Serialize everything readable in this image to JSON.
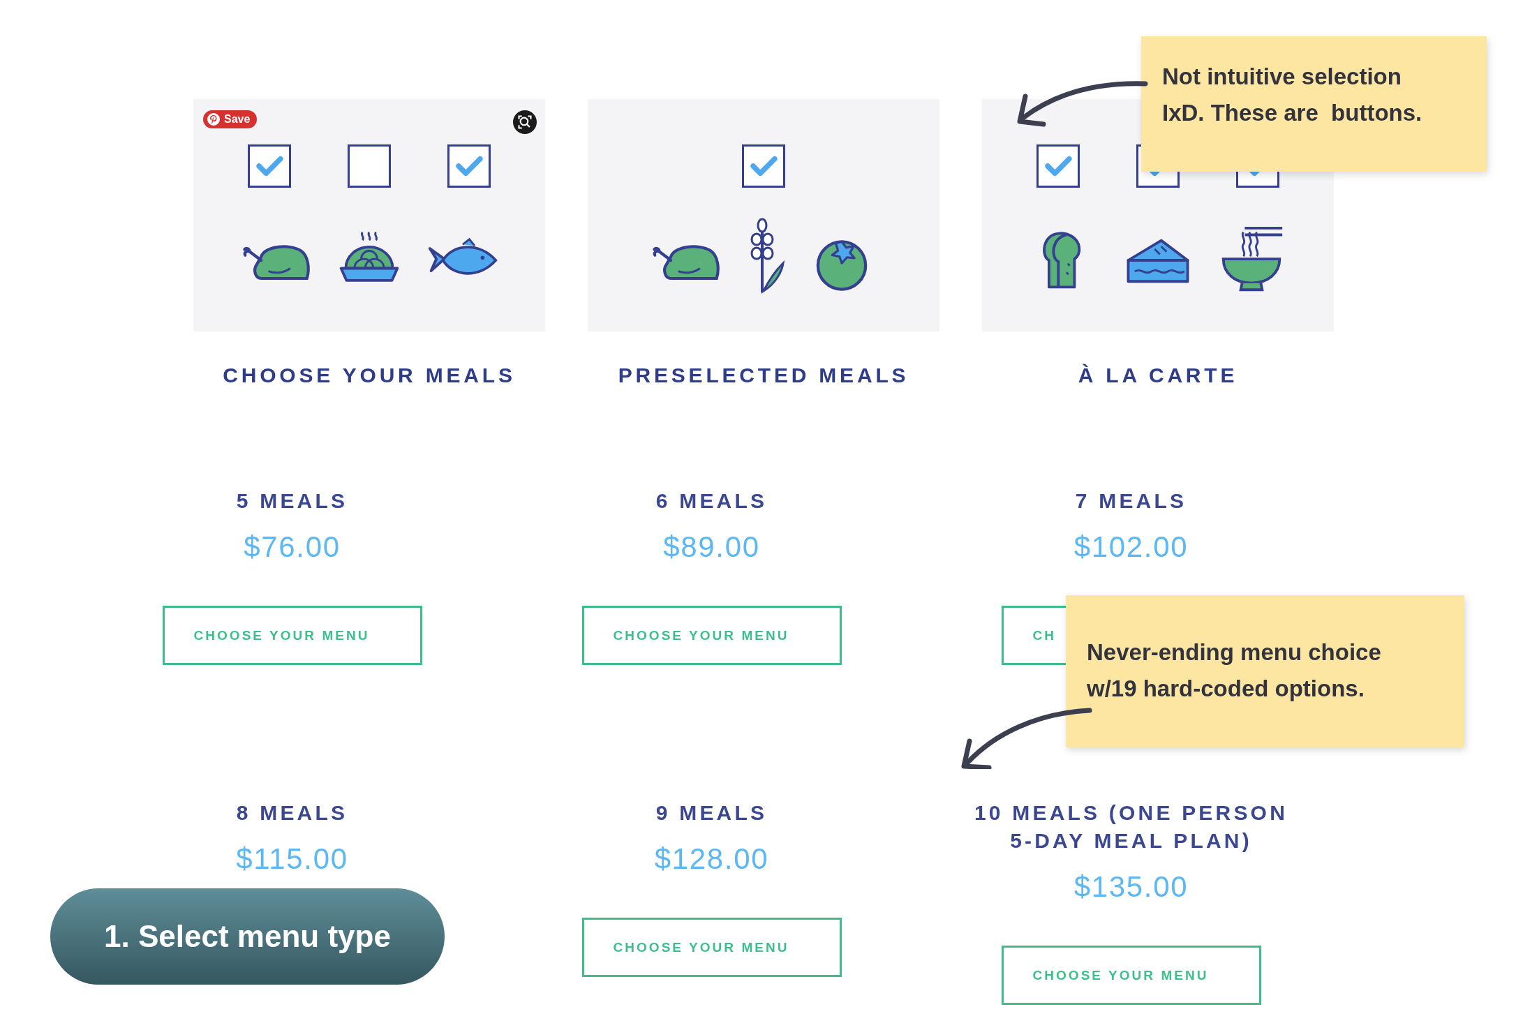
{
  "cards": [
    {
      "title": "CHOOSE YOUR MEALS",
      "save_badge": "Save",
      "visual_search": true,
      "checkboxes": [
        {
          "checked": true
        },
        {
          "checked": false
        },
        {
          "checked": true
        }
      ]
    },
    {
      "title": "PRESELECTED MEALS",
      "checkboxes": [
        {
          "checked": true
        }
      ]
    },
    {
      "title": "À LA CARTE",
      "checkboxes": [
        {
          "checked": true
        },
        {
          "checked": true
        },
        {
          "checked": true
        }
      ]
    }
  ],
  "plans": [
    {
      "label": "5 MEALS",
      "price": "$76.00",
      "button": "CHOOSE YOUR MENU"
    },
    {
      "label": "6 MEALS",
      "price": "$89.00",
      "button": "CHOOSE YOUR MENU"
    },
    {
      "label": "7 MEALS",
      "price": "$102.00",
      "button": "CH"
    },
    {
      "label": "8 MEALS",
      "price": "$115.00"
    },
    {
      "label": "9 MEALS",
      "price": "$128.00",
      "button": "CHOOSE YOUR MENU"
    },
    {
      "label": "10 MEALS (ONE PERSON\n5-DAY MEAL PLAN)",
      "price": "$135.00",
      "button": "CHOOSE YOUR MENU"
    }
  ],
  "notes": [
    {
      "text": "Not intuitive selection\nIxD. These are  buttons."
    },
    {
      "text": "Never-ending menu choice\nw/19 hard-coded options."
    }
  ],
  "step_label": "1. Select menu type"
}
